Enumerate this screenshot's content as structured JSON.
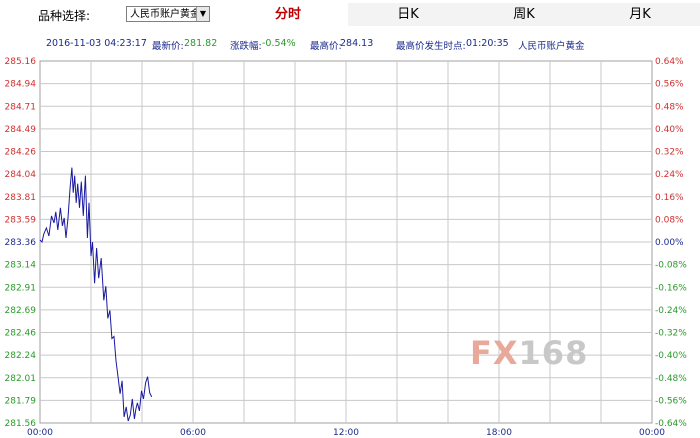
{
  "header": {
    "variety_label": "品种选择:",
    "variety_selected": "人民币账户黄金",
    "tabs": [
      {
        "label": "分时",
        "active": true
      },
      {
        "label": "日K",
        "active": false
      },
      {
        "label": "周K",
        "active": false
      },
      {
        "label": "月K",
        "active": false
      }
    ]
  },
  "info": {
    "datetime": "2016-11-03 04:23:17",
    "latest_label": "最新价:",
    "latest_value": "281.82",
    "change_label": "涨跌幅:",
    "change_value": "-0.54%",
    "high_label": "最高价:",
    "high_value": "284.13",
    "high_time_label": "最高价发生时点:",
    "high_time_value": "01:20:35",
    "product": "人民币账户黄金"
  },
  "watermark": {
    "text1": "FX",
    "text2": "168"
  },
  "colors": {
    "line": "#1a1aa0",
    "up": "#d03030",
    "down": "#2a9a2a",
    "grid": "#c8c8c8"
  },
  "chart_data": {
    "type": "line",
    "title": "",
    "xlabel": "",
    "ylabel": "",
    "x_ticks": [
      "00:00",
      "06:00",
      "12:00",
      "18:00",
      "00:00"
    ],
    "x_range_hours": [
      0,
      24
    ],
    "ylim": [
      281.56,
      285.16
    ],
    "y_ticks_left": [
      "285.16",
      "284.94",
      "284.71",
      "284.49",
      "284.26",
      "284.04",
      "283.81",
      "283.59",
      "283.36",
      "283.14",
      "282.91",
      "282.69",
      "282.46",
      "282.24",
      "282.01",
      "281.79",
      "281.56"
    ],
    "y_ticks_right": [
      "0.64%",
      "0.56%",
      "0.48%",
      "0.40%",
      "0.32%",
      "0.24%",
      "0.16%",
      "0.08%",
      "0.00%",
      "-0.08%",
      "-0.16%",
      "-0.24%",
      "-0.32%",
      "-0.40%",
      "-0.48%",
      "-0.56%",
      "-0.64%"
    ],
    "grid": true,
    "series": [
      {
        "x": [
          0.0,
          0.08,
          0.15,
          0.25,
          0.35,
          0.45,
          0.55,
          0.62,
          0.7,
          0.8,
          0.88,
          0.95,
          1.02,
          1.1,
          1.18,
          1.25,
          1.3,
          1.36,
          1.42,
          1.48,
          1.55,
          1.62,
          1.7,
          1.78,
          1.86,
          1.92,
          2.0,
          2.06,
          2.14,
          2.22,
          2.3,
          2.4,
          2.5,
          2.58,
          2.66,
          2.74,
          2.82,
          2.9,
          2.98,
          3.06,
          3.14,
          3.22,
          3.3,
          3.38,
          3.46,
          3.54,
          3.62,
          3.7,
          3.76,
          3.82,
          3.9,
          3.98,
          4.06,
          4.14,
          4.22,
          4.3,
          4.38
        ],
        "y": [
          283.38,
          283.36,
          283.44,
          283.5,
          283.42,
          283.62,
          283.55,
          283.66,
          283.48,
          283.7,
          283.52,
          283.6,
          283.4,
          283.6,
          283.9,
          284.1,
          283.85,
          284.02,
          283.75,
          283.94,
          283.7,
          283.96,
          283.62,
          284.02,
          283.4,
          283.75,
          283.22,
          283.36,
          282.95,
          283.3,
          283.0,
          283.2,
          282.78,
          282.92,
          282.6,
          282.68,
          282.4,
          282.42,
          282.18,
          282.02,
          281.85,
          281.98,
          281.62,
          281.72,
          281.58,
          281.64,
          281.8,
          281.6,
          281.7,
          281.76,
          281.68,
          281.88,
          281.8,
          281.96,
          282.02,
          281.86,
          281.82
        ]
      }
    ]
  }
}
